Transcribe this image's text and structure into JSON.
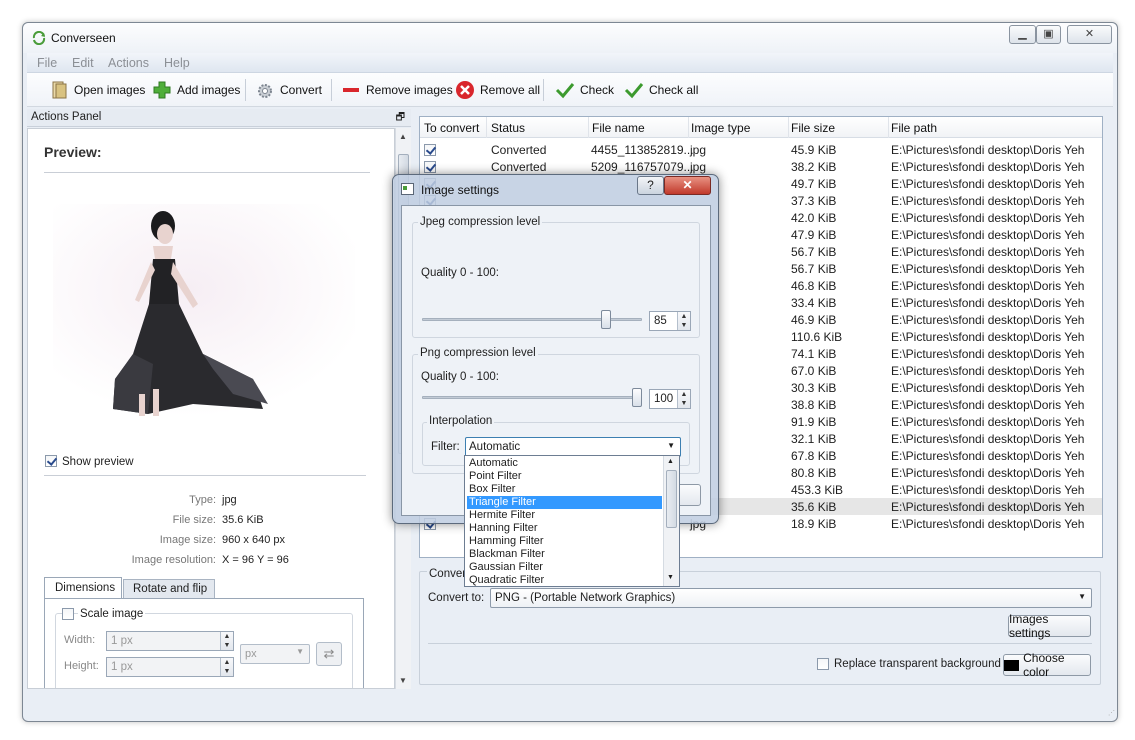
{
  "app": {
    "title": "Converseen"
  },
  "menu": [
    "File",
    "Edit",
    "Actions",
    "Help"
  ],
  "toolbar": {
    "open_images": "Open images",
    "add_images": "Add images",
    "convert": "Convert",
    "remove_images": "Remove images",
    "remove_all": "Remove all",
    "check": "Check",
    "check_all": "Check all"
  },
  "actions_panel": {
    "title": "Actions Panel",
    "preview_label": "Preview:",
    "show_preview": "Show preview",
    "info": {
      "type_label": "Type:",
      "type_value": "jpg",
      "size_label": "File size:",
      "size_value": "35.6 KiB",
      "img_size_label": "Image size:",
      "img_size_value": "960 x 640 px",
      "res_label": "Image resolution:",
      "res_value": "X = 96 Y = 96"
    },
    "tabs": [
      "Dimensions",
      "Rotate and flip"
    ],
    "scale_image": "Scale image",
    "width_label": "Width:",
    "width_value": "1 px",
    "height_label": "Height:",
    "height_value": "1 px",
    "unit": "px"
  },
  "table": {
    "headers": [
      "To convert",
      "Status",
      "File name",
      "Image type",
      "File size",
      "File path"
    ],
    "rows": [
      {
        "status": "Converted",
        "name": "4455_113852819...",
        "type": "jpg",
        "size": "45.9 KiB",
        "path": "E:\\Pictures\\sfondi desktop\\Doris Yeh"
      },
      {
        "status": "Converted",
        "name": "5209_116757079...",
        "type": "jpg",
        "size": "38.2 KiB",
        "path": "E:\\Pictures\\sfondi desktop\\Doris Yeh"
      },
      {
        "status": "",
        "name": "",
        "type": "",
        "size": "49.7 KiB",
        "path": "E:\\Pictures\\sfondi desktop\\Doris Yeh"
      },
      {
        "status": "",
        "name": "",
        "type": "",
        "size": "37.3 KiB",
        "path": "E:\\Pictures\\sfondi desktop\\Doris Yeh"
      },
      {
        "status": "",
        "name": "",
        "type": "",
        "size": "42.0 KiB",
        "path": "E:\\Pictures\\sfondi desktop\\Doris Yeh"
      },
      {
        "status": "",
        "name": "",
        "type": "",
        "size": "47.9 KiB",
        "path": "E:\\Pictures\\sfondi desktop\\Doris Yeh"
      },
      {
        "status": "",
        "name": "",
        "type": "",
        "size": "56.7 KiB",
        "path": "E:\\Pictures\\sfondi desktop\\Doris Yeh"
      },
      {
        "status": "",
        "name": "",
        "type": "",
        "size": "56.7 KiB",
        "path": "E:\\Pictures\\sfondi desktop\\Doris Yeh"
      },
      {
        "status": "",
        "name": "",
        "type": "",
        "size": "46.8 KiB",
        "path": "E:\\Pictures\\sfondi desktop\\Doris Yeh"
      },
      {
        "status": "",
        "name": "",
        "type": "",
        "size": "33.4 KiB",
        "path": "E:\\Pictures\\sfondi desktop\\Doris Yeh"
      },
      {
        "status": "",
        "name": "",
        "type": "",
        "size": "46.9 KiB",
        "path": "E:\\Pictures\\sfondi desktop\\Doris Yeh"
      },
      {
        "status": "",
        "name": "",
        "type": "",
        "size": "110.6 KiB",
        "path": "E:\\Pictures\\sfondi desktop\\Doris Yeh"
      },
      {
        "status": "",
        "name": "",
        "type": "",
        "size": "74.1 KiB",
        "path": "E:\\Pictures\\sfondi desktop\\Doris Yeh"
      },
      {
        "status": "",
        "name": "",
        "type": "",
        "size": "67.0 KiB",
        "path": "E:\\Pictures\\sfondi desktop\\Doris Yeh"
      },
      {
        "status": "",
        "name": "",
        "type": "",
        "size": "30.3 KiB",
        "path": "E:\\Pictures\\sfondi desktop\\Doris Yeh"
      },
      {
        "status": "",
        "name": "",
        "type": "",
        "size": "38.8 KiB",
        "path": "E:\\Pictures\\sfondi desktop\\Doris Yeh"
      },
      {
        "status": "",
        "name": "",
        "type": "",
        "size": "91.9 KiB",
        "path": "E:\\Pictures\\sfondi desktop\\Doris Yeh"
      },
      {
        "status": "",
        "name": "",
        "type": "",
        "size": "32.1 KiB",
        "path": "E:\\Pictures\\sfondi desktop\\Doris Yeh"
      },
      {
        "status": "",
        "name": "",
        "type": "",
        "size": "67.8 KiB",
        "path": "E:\\Pictures\\sfondi desktop\\Doris Yeh"
      },
      {
        "status": "",
        "name": "",
        "type": "",
        "size": "80.8 KiB",
        "path": "E:\\Pictures\\sfondi desktop\\Doris Yeh"
      },
      {
        "status": "",
        "name": "",
        "type": "",
        "size": "453.3 KiB",
        "path": "E:\\Pictures\\sfondi desktop\\Doris Yeh"
      },
      {
        "status": "",
        "name": "",
        "type": "",
        "size": "35.6 KiB",
        "path": "E:\\Pictures\\sfondi desktop\\Doris Yeh"
      },
      {
        "status": "",
        "name": "",
        "type": "jpg",
        "size": "18.9 KiB",
        "path": "E:\\Pictures\\sfondi desktop\\Doris Yeh"
      }
    ]
  },
  "conversion": {
    "group_label": "Convers",
    "convert_to_label": "Convert to:",
    "convert_to_value": "PNG - (Portable Network Graphics)",
    "images_settings": "Images settings",
    "replace_bg": "Replace transparent background",
    "choose_color": "Choose color"
  },
  "dialog": {
    "title": "Image settings",
    "jpeg_group": "Jpeg compression level",
    "jpeg_quality_label": "Quality 0 - 100:",
    "jpeg_quality": "85",
    "png_group": "Png compression level",
    "png_quality_label": "Quality 0 - 100:",
    "png_quality": "100",
    "interp_group": "Interpolation",
    "filter_label": "Filter:",
    "filter_value": "Automatic",
    "filter_options": [
      "Automatic",
      "Point Filter",
      "Box Filter",
      "Triangle Filter",
      "Hermite Filter",
      "Hanning Filter",
      "Hamming Filter",
      "Blackman Filter",
      "Gaussian Filter",
      "Quadratic Filter"
    ],
    "selected_option": "Triangle Filter"
  },
  "colors": {
    "accent": "#3399ff",
    "brand_green": "#3c9a2e",
    "remove_red": "#d9262c"
  }
}
